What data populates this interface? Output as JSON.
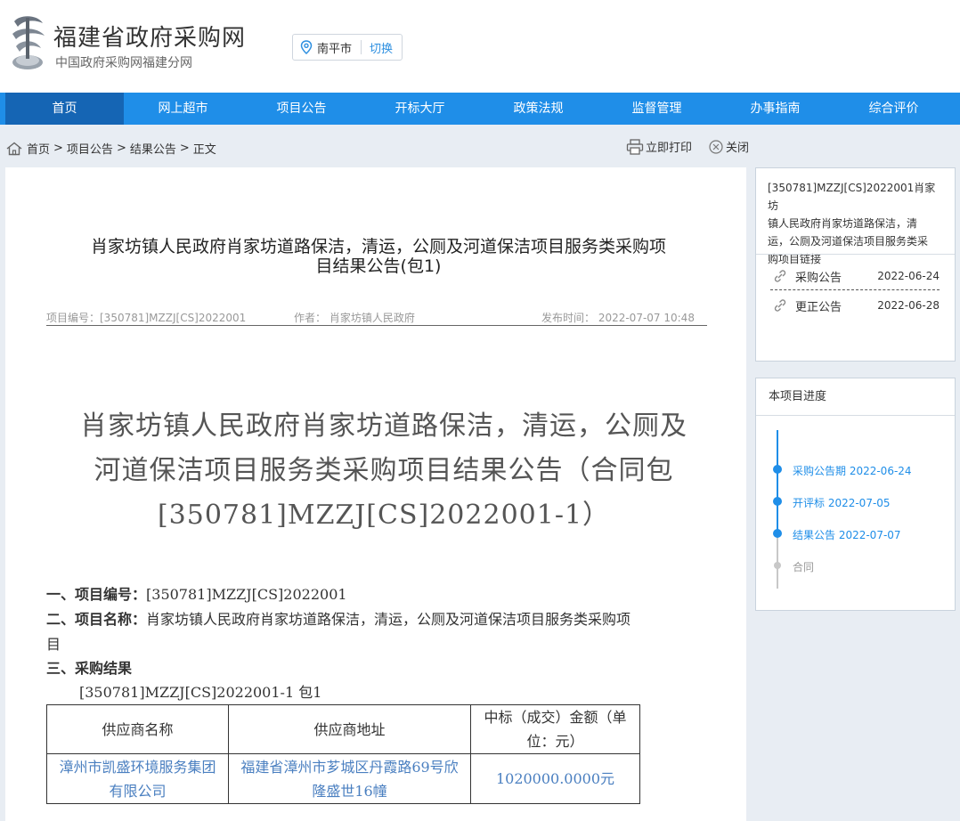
{
  "header": {
    "site_title": "福建省政府采购网",
    "site_subtitle": "中国政府采购网福建分网",
    "city": "南平市",
    "city_switch": "切换"
  },
  "nav": [
    {
      "label": "首页",
      "active": true
    },
    {
      "label": "网上超市"
    },
    {
      "label": "项目公告"
    },
    {
      "label": "开标大厅"
    },
    {
      "label": "政策法规"
    },
    {
      "label": "监督管理"
    },
    {
      "label": "办事指南"
    },
    {
      "label": "综合评价"
    }
  ],
  "breadcrumb": {
    "home": "首页",
    "sep": ">",
    "level1": "项目公告",
    "level2": "结果公告",
    "level3": "正文"
  },
  "tools": {
    "print": "立即打印",
    "close": "关闭"
  },
  "article": {
    "title_line1": "肖家坊镇人民政府肖家坊道路保洁，清运，公厕及河道保洁项目服务类采购项",
    "title_line2": "目结果公告(包1)",
    "meta_project_no": "项目编号：[350781]MZZJ[CS]2022001",
    "meta_author": "作者：  肖家坊镇人民政府",
    "meta_published": "发布时间：  2022-07-07 10:48",
    "doc_title_line1": "肖家坊镇人民政府肖家坊道路保洁，清运，公厕及",
    "doc_title_line2": "河道保洁项目服务类采购项目结果公告（合同包",
    "doc_title_line3": "[350781]MZZJ[CS]2022001-1）",
    "sec1_label": "一、项目编号：",
    "sec1_value": "[350781]MZZJ[CS]2022001",
    "sec2_label": "二、项目名称：",
    "sec2_value_line1": "肖家坊镇人民政府肖家坊道路保洁，清运，公厕及河道保洁项目服务类采购项",
    "sec2_value_line2": "目",
    "sec3_label": "三、采购结果",
    "package_line": "[350781]MZZJ[CS]2022001-1 包1",
    "table_headers": [
      "供应商名称",
      "供应商地址",
      "中标（成交）金额（单位：元）"
    ],
    "table_header3_line1": "中标（成交）金额（单",
    "table_header3_line2": "位：元）",
    "table_rows": [
      {
        "name_line1": "漳州市凯盛环境服务集团",
        "name_line2": "有限公司",
        "address_line1": "福建省漳州市芗城区丹霞路69号欣",
        "address_line2": "隆盛世16幢",
        "amount": "1020000.0000元"
      }
    ]
  },
  "related_panel": {
    "heading": "[350781]MZZJ[CS]2022001肖家坊镇人民政府肖家坊道路保洁，清运，公厕及河道保洁项目服务类采购项目链接",
    "heading_lines": [
      "[350781]MZZJ[CS]2022001肖家坊",
      "镇人民政府肖家坊道路保洁，清",
      "运，公厕及河道保洁项目服务类采",
      "购项目链接"
    ],
    "links": [
      {
        "label": "采购公告",
        "date": "2022-06-24"
      },
      {
        "label": "更正公告",
        "date": "2022-06-28"
      }
    ]
  },
  "progress_panel": {
    "heading": "本项目进度",
    "steps": [
      {
        "label": "采购公告期 2022-06-24",
        "done": true
      },
      {
        "label": "开评标 2022-07-05",
        "done": true
      },
      {
        "label": "结果公告 2022-07-07",
        "done": true
      },
      {
        "label": "合同",
        "done": false
      }
    ]
  },
  "colors": {
    "nav_bg": "#1f8ee8",
    "nav_active": "#1565b4",
    "accent": "#2d8fe0",
    "page_bg": "#e8edf3",
    "timeline_done": "#1f8ee8",
    "timeline_pending": "#c8c8c8"
  }
}
